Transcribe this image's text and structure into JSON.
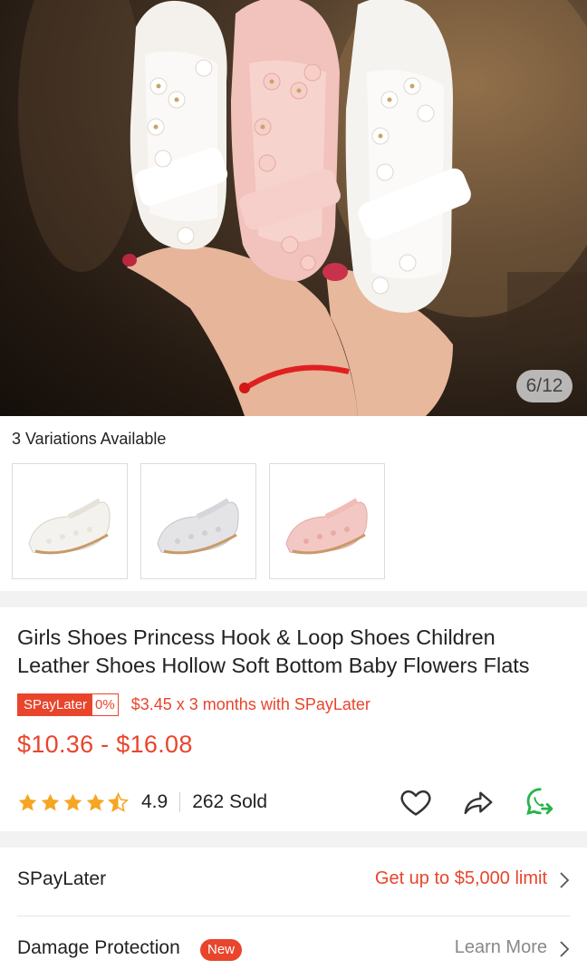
{
  "gallery": {
    "counter": "6/12"
  },
  "variations": {
    "title": "3 Variations Available",
    "items": [
      {
        "color": "white"
      },
      {
        "color": "silver"
      },
      {
        "color": "pink"
      }
    ]
  },
  "product": {
    "title": "Girls Shoes Princess Hook & Loop Shoes Children Leather Shoes Hollow Soft Bottom Baby Flowers Flats",
    "spaylater_badge": "SPayLater",
    "spaylater_rate": "0%",
    "installment_text": "$3.45 x 3 months with SPayLater",
    "price": "$10.36 - $16.08",
    "rating": "4.9",
    "rating_value": 4.9,
    "sold": "262 Sold"
  },
  "rows": {
    "spaylater": {
      "label": "SPayLater",
      "right": "Get up to $5,000 limit"
    },
    "damage": {
      "label": "Damage Protection",
      "badge": "New",
      "right": "Learn More"
    }
  },
  "colors": {
    "accent": "#e8452c",
    "star": "#f5a623",
    "whatsapp": "#25b44a"
  }
}
